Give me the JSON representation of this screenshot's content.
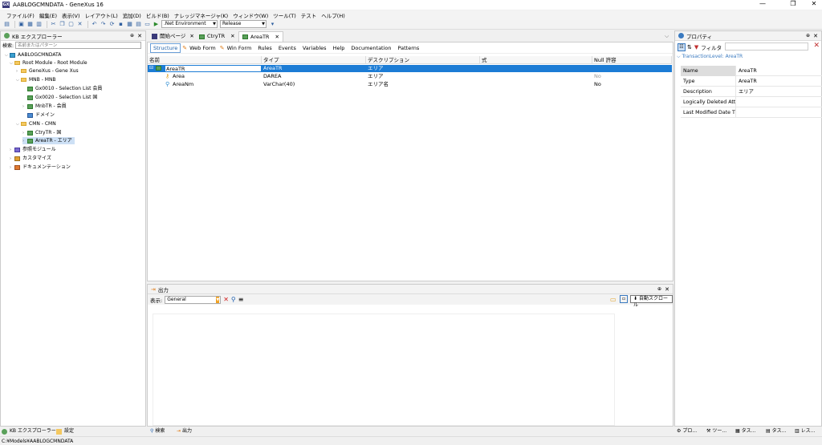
{
  "window": {
    "title": "AABLOGCMNDATA - GeneXus 16",
    "app_icon": "GX",
    "minimize": "—",
    "maximize": "❐",
    "close": "✕"
  },
  "menu": {
    "items": [
      "ファイル(F)",
      "編集(E)",
      "表示(V)",
      "レイアウト(L)",
      "追加(D)",
      "ビルド(B)",
      "ナレッジマネージャ(K)",
      "ウィンドウ(W)",
      "ツール(T)",
      "テスト",
      "ヘルプ(H)"
    ]
  },
  "toolbar": {
    "environment": ".Net Environment",
    "configuration": "Release"
  },
  "kb_explorer": {
    "title": "KB エクスプローラー",
    "search_label": "検索:",
    "search_placeholder": "名前またはパターン",
    "root": "AABLOGCMNDATA",
    "items": [
      {
        "label": "Root Module - Root Module"
      },
      {
        "label": "GeneXus - Gene Xus"
      },
      {
        "label": "MNB - MNB"
      },
      {
        "label": "Gx0010 - Selection List 会員"
      },
      {
        "label": "Gx0020 - Selection List 国"
      },
      {
        "label": "MnbTR - 会員"
      },
      {
        "label": "ドメイン"
      },
      {
        "label": "CMN - CMN"
      },
      {
        "label": "CtryTR - 国"
      },
      {
        "label": "AreaTR - エリア"
      },
      {
        "label": "参照モジュール"
      },
      {
        "label": "カスタマイズ"
      },
      {
        "label": "ドキュメンテーション"
      }
    ]
  },
  "doc_tabs": [
    {
      "label": "開始ページ"
    },
    {
      "label": "CtryTR"
    },
    {
      "label": "AreaTR"
    }
  ],
  "sub_tabs": [
    "Structure",
    "Web Form",
    "Win Form",
    "Rules",
    "Events",
    "Variables",
    "Help",
    "Documentation",
    "Patterns"
  ],
  "structure": {
    "headers": [
      "名前",
      "タイプ",
      "デスクリプション",
      "式",
      "Null 許容"
    ],
    "rows": [
      {
        "name": "AreaTR",
        "type": "AreaTR",
        "desc": "エリア",
        "formula": "",
        "nullable": ""
      },
      {
        "name": "Area",
        "type": "DAREA",
        "desc": "エリア",
        "formula": "",
        "nullable": "No"
      },
      {
        "name": "AreaNm",
        "type": "VarChar(40)",
        "desc": "エリア名",
        "formula": "",
        "nullable": "No"
      }
    ]
  },
  "output": {
    "title": "出力",
    "show_label": "表示:",
    "show_value": "General",
    "auto_scroll": "自動スクロール"
  },
  "properties": {
    "title": "プロパティ",
    "filter_label": "フィルタ",
    "level": "TransactionLevel: AreaTR",
    "rows": [
      {
        "key": "Name",
        "value": "AreaTR"
      },
      {
        "key": "Type",
        "value": "AreaTR"
      },
      {
        "key": "Description",
        "value": "エリア"
      },
      {
        "key": "Logically Deleted Attril",
        "value": ""
      },
      {
        "key": "Last Modified Date Tim",
        "value": ""
      }
    ]
  },
  "bottom_tabs": {
    "left": [
      "KB エクスプローラー",
      "設定"
    ],
    "middle": [
      "検索",
      "出力"
    ],
    "right": [
      "プロ...",
      "ツー...",
      "タス...",
      "タス...",
      "レス..."
    ]
  },
  "status": "C:¥Models¥AABLOGCMNDATA",
  "colors": {
    "selection": "#1c7cd5",
    "accent": "#1c5fa8",
    "folder": "#f4c860"
  }
}
